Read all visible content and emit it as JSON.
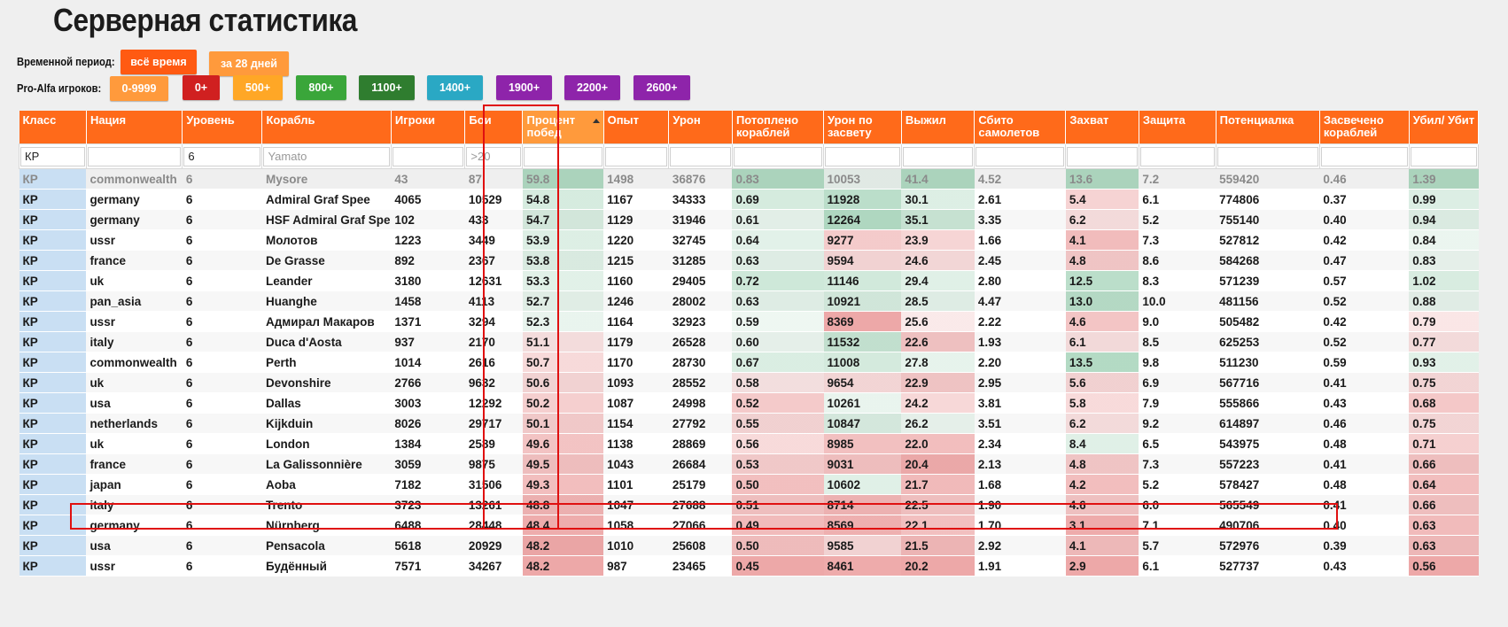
{
  "page": {
    "title": "Серверная статистика"
  },
  "filters": {
    "period_label": "Временной период:",
    "period_buttons": [
      {
        "label": "всё время",
        "color": "#ff5a12",
        "selected": true
      },
      {
        "label": "за 28 дней",
        "color": "#ff9a3c",
        "selected": false
      }
    ],
    "players_label": "Pro-Alfa игроков:",
    "player_buttons": [
      {
        "label": "0-9999",
        "color": "#ff9a3c"
      },
      {
        "label": "0+",
        "color": "#d02020"
      },
      {
        "label": "500+",
        "color": "#ffa726"
      },
      {
        "label": "800+",
        "color": "#3aa63a"
      },
      {
        "label": "1100+",
        "color": "#2f7d2f"
      },
      {
        "label": "1400+",
        "color": "#2aa8c4"
      },
      {
        "label": "1900+",
        "color": "#8e24aa"
      },
      {
        "label": "2200+",
        "color": "#8e24aa"
      },
      {
        "label": "2600+",
        "color": "#8e24aa"
      }
    ]
  },
  "table": {
    "sorted_column": 6,
    "columns": [
      "Класс",
      "Нация",
      "Уровень",
      "Корабль",
      "Игроки",
      "Бои",
      "Процент побед",
      "Опыт",
      "Урон",
      "Потоплено кораблей",
      "Урон по засвету",
      "Выжил",
      "Сбито самолетов",
      "Захват",
      "Защита",
      "Потенциалка",
      "Засвечено кораблей",
      "Убил/ Убит"
    ],
    "filter_values": [
      "КР",
      "",
      "6",
      "",
      "",
      "",
      "",
      "",
      "",
      "",
      "",
      "",
      "",
      "",
      "",
      "",
      "",
      ""
    ],
    "filter_placeholders": [
      "",
      "",
      "",
      "Yamato",
      "",
      ">20",
      "",
      "",
      "",
      "",
      "",
      "",
      "",
      "",
      "",
      "",
      "",
      ""
    ],
    "rows": [
      [
        "КР",
        "commonwealth",
        "6",
        "Mysore",
        "43",
        "87",
        "59.8",
        "1498",
        "36876",
        "0.83",
        "10053",
        "41.4",
        "4.52",
        "13.6",
        "7.2",
        "559420",
        "0.46",
        "1.39"
      ],
      [
        "КР",
        "germany",
        "6",
        "Admiral Graf Spee",
        "4065",
        "10529",
        "54.8",
        "1167",
        "34333",
        "0.69",
        "11928",
        "30.1",
        "2.61",
        "5.4",
        "6.1",
        "774806",
        "0.37",
        "0.99"
      ],
      [
        "КР",
        "germany",
        "6",
        "HSF Admiral Graf Spee",
        "102",
        "433",
        "54.7",
        "1129",
        "31946",
        "0.61",
        "12264",
        "35.1",
        "3.35",
        "6.2",
        "5.2",
        "755140",
        "0.40",
        "0.94"
      ],
      [
        "КР",
        "ussr",
        "6",
        "Молотов",
        "1223",
        "3449",
        "53.9",
        "1220",
        "32745",
        "0.64",
        "9277",
        "23.9",
        "1.66",
        "4.1",
        "7.3",
        "527812",
        "0.42",
        "0.84"
      ],
      [
        "КР",
        "france",
        "6",
        "De Grasse",
        "892",
        "2367",
        "53.8",
        "1215",
        "31285",
        "0.63",
        "9594",
        "24.6",
        "2.45",
        "4.8",
        "8.6",
        "584268",
        "0.47",
        "0.83"
      ],
      [
        "КР",
        "uk",
        "6",
        "Leander",
        "3180",
        "12631",
        "53.3",
        "1160",
        "29405",
        "0.72",
        "11146",
        "29.4",
        "2.80",
        "12.5",
        "8.3",
        "571239",
        "0.57",
        "1.02"
      ],
      [
        "КР",
        "pan_asia",
        "6",
        "Huanghe",
        "1458",
        "4113",
        "52.7",
        "1246",
        "28002",
        "0.63",
        "10921",
        "28.5",
        "4.47",
        "13.0",
        "10.0",
        "481156",
        "0.52",
        "0.88"
      ],
      [
        "КР",
        "ussr",
        "6",
        "Адмирал Макаров",
        "1371",
        "3294",
        "52.3",
        "1164",
        "32923",
        "0.59",
        "8369",
        "25.6",
        "2.22",
        "4.6",
        "9.0",
        "505482",
        "0.42",
        "0.79"
      ],
      [
        "КР",
        "italy",
        "6",
        "Duca d'Aosta",
        "937",
        "2170",
        "51.1",
        "1179",
        "26528",
        "0.60",
        "11532",
        "22.6",
        "1.93",
        "6.1",
        "8.5",
        "625253",
        "0.52",
        "0.77"
      ],
      [
        "КР",
        "commonwealth",
        "6",
        "Perth",
        "1014",
        "2616",
        "50.7",
        "1170",
        "28730",
        "0.67",
        "11008",
        "27.8",
        "2.20",
        "13.5",
        "9.8",
        "511230",
        "0.59",
        "0.93"
      ],
      [
        "КР",
        "uk",
        "6",
        "Devonshire",
        "2766",
        "9632",
        "50.6",
        "1093",
        "28552",
        "0.58",
        "9654",
        "22.9",
        "2.95",
        "5.6",
        "6.9",
        "567716",
        "0.41",
        "0.75"
      ],
      [
        "КР",
        "usa",
        "6",
        "Dallas",
        "3003",
        "12292",
        "50.2",
        "1087",
        "24998",
        "0.52",
        "10261",
        "24.2",
        "3.81",
        "5.8",
        "7.9",
        "555866",
        "0.43",
        "0.68"
      ],
      [
        "КР",
        "netherlands",
        "6",
        "Kijkduin",
        "8026",
        "29717",
        "50.1",
        "1154",
        "27792",
        "0.55",
        "10847",
        "26.2",
        "3.51",
        "6.2",
        "9.2",
        "614897",
        "0.46",
        "0.75"
      ],
      [
        "КР",
        "uk",
        "6",
        "London",
        "1384",
        "2589",
        "49.6",
        "1138",
        "28869",
        "0.56",
        "8985",
        "22.0",
        "2.34",
        "8.4",
        "6.5",
        "543975",
        "0.48",
        "0.71"
      ],
      [
        "КР",
        "france",
        "6",
        "La Galissonnière",
        "3059",
        "9875",
        "49.5",
        "1043",
        "26684",
        "0.53",
        "9031",
        "20.4",
        "2.13",
        "4.8",
        "7.3",
        "557223",
        "0.41",
        "0.66"
      ],
      [
        "КР",
        "japan",
        "6",
        "Aoba",
        "7182",
        "31506",
        "49.3",
        "1101",
        "25179",
        "0.50",
        "10602",
        "21.7",
        "1.68",
        "4.2",
        "5.2",
        "578427",
        "0.48",
        "0.64"
      ],
      [
        "КР",
        "italy",
        "6",
        "Trento",
        "3723",
        "13261",
        "48.8",
        "1047",
        "27688",
        "0.51",
        "8714",
        "22.5",
        "1.90",
        "4.6",
        "6.0",
        "565549",
        "0.41",
        "0.66"
      ],
      [
        "КР",
        "germany",
        "6",
        "Nürnberg",
        "6488",
        "28448",
        "48.4",
        "1058",
        "27066",
        "0.49",
        "8569",
        "22.1",
        "1.70",
        "3.1",
        "7.1",
        "490706",
        "0.40",
        "0.63"
      ],
      [
        "КР",
        "usa",
        "6",
        "Pensacola",
        "5618",
        "20929",
        "48.2",
        "1010",
        "25608",
        "0.50",
        "9585",
        "21.5",
        "2.92",
        "4.1",
        "5.7",
        "572976",
        "0.39",
        "0.63"
      ],
      [
        "КР",
        "ussr",
        "6",
        "Будённый",
        "7571",
        "34267",
        "48.2",
        "987",
        "23465",
        "0.45",
        "8461",
        "20.2",
        "1.91",
        "2.9",
        "6.1",
        "527737",
        "0.43",
        "0.56"
      ]
    ]
  }
}
